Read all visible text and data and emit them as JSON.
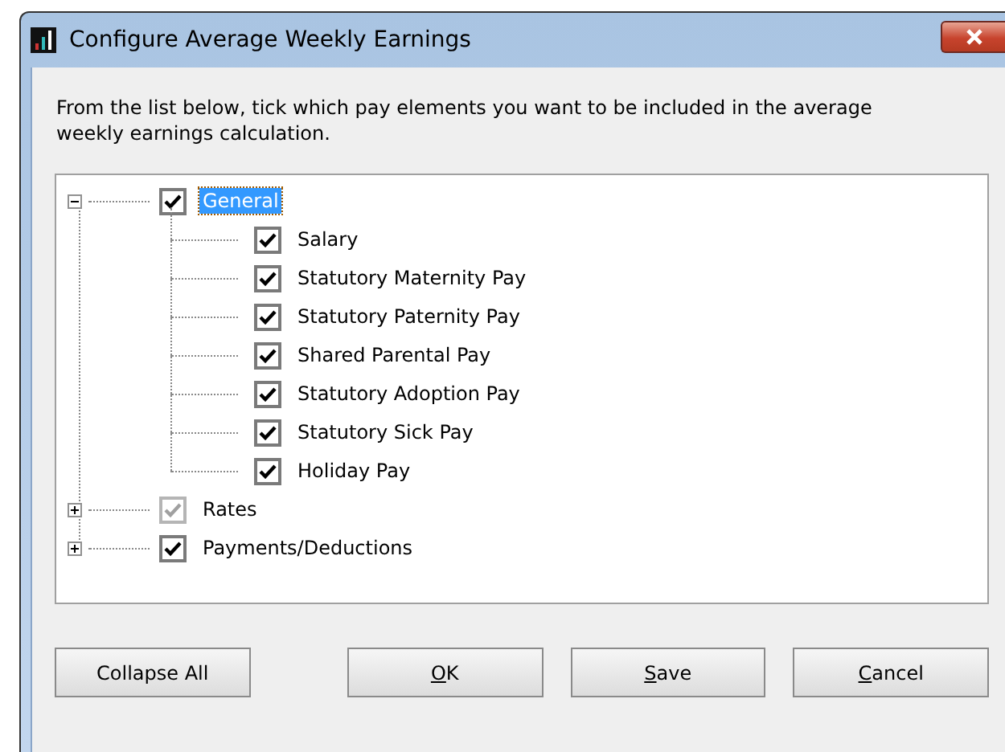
{
  "window": {
    "title": "Configure Average Weekly Earnings"
  },
  "instructions": "From the list below, tick which pay elements you want to be included in the average weekly earnings calculation.",
  "tree": [
    {
      "label": "General",
      "checked": true,
      "disabled": false,
      "expanded": true,
      "selected": true,
      "children": [
        {
          "label": "Salary",
          "checked": true,
          "disabled": false,
          "selected": false
        },
        {
          "label": "Statutory Maternity Pay",
          "checked": true,
          "disabled": false,
          "selected": false
        },
        {
          "label": "Statutory Paternity Pay",
          "checked": true,
          "disabled": false,
          "selected": false
        },
        {
          "label": "Shared Parental Pay",
          "checked": true,
          "disabled": false,
          "selected": false
        },
        {
          "label": "Statutory Adoption Pay",
          "checked": true,
          "disabled": false,
          "selected": false
        },
        {
          "label": "Statutory Sick Pay",
          "checked": true,
          "disabled": false,
          "selected": false
        },
        {
          "label": "Holiday Pay",
          "checked": true,
          "disabled": false,
          "selected": false
        }
      ]
    },
    {
      "label": "Rates",
      "checked": true,
      "disabled": true,
      "expanded": false,
      "selected": false
    },
    {
      "label": "Payments/Deductions",
      "checked": true,
      "disabled": false,
      "expanded": false,
      "selected": false
    }
  ],
  "buttons": [
    {
      "label": "Collapse All",
      "mnemonic": false
    },
    {
      "label": "OK",
      "mnemonic": true
    },
    {
      "label": "Save",
      "mnemonic": true
    },
    {
      "label": "Cancel",
      "mnemonic": true
    }
  ]
}
